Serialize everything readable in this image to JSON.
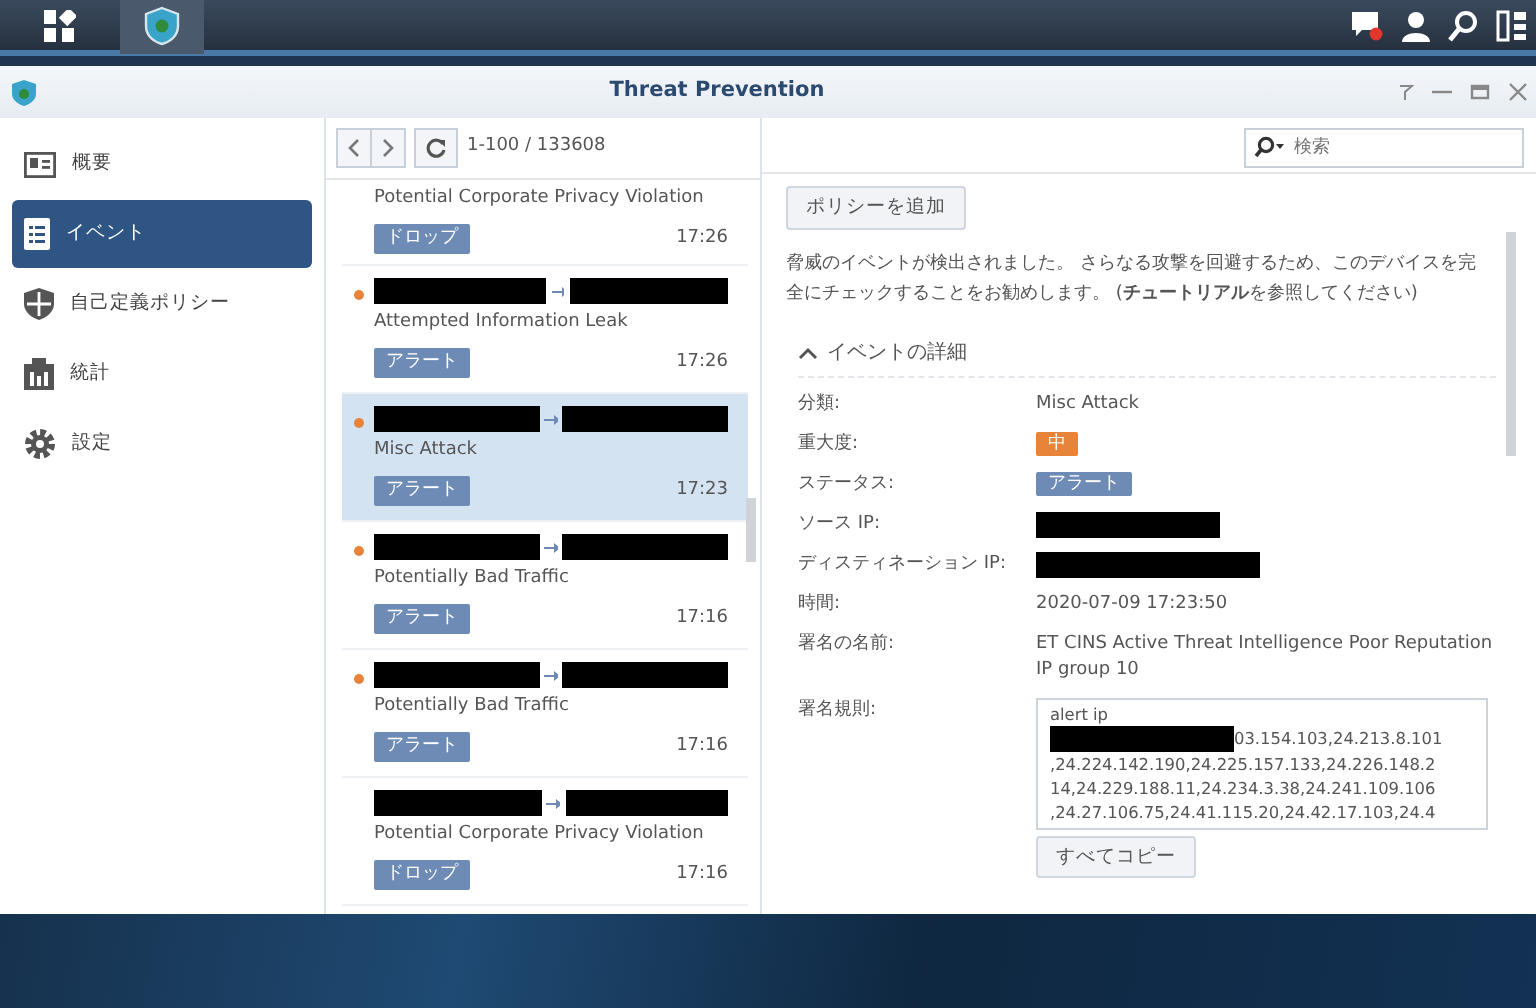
{
  "window": {
    "title": "Threat Prevention"
  },
  "sidebar": {
    "items": [
      {
        "label": "概要",
        "selected": false
      },
      {
        "label": "イベント",
        "selected": true
      },
      {
        "label": "自己定義ポリシー",
        "selected": false
      },
      {
        "label": "統計",
        "selected": false
      },
      {
        "label": "設定",
        "selected": false
      }
    ]
  },
  "toolbar": {
    "pager": "1-100 / 133608",
    "search": {
      "placeholder": "検索"
    }
  },
  "events": [
    {
      "category": "Potential Corporate Privacy Violation",
      "action": "ドロップ",
      "time": "17:26",
      "new": false,
      "selected": false
    },
    {
      "category": "Attempted Information Leak",
      "action": "アラート",
      "time": "17:26",
      "new": true,
      "selected": false
    },
    {
      "category": "Misc Attack",
      "action": "アラート",
      "time": "17:23",
      "new": true,
      "selected": true
    },
    {
      "category": "Potentially Bad Traffic",
      "action": "アラート",
      "time": "17:16",
      "new": true,
      "selected": false
    },
    {
      "category": "Potentially Bad Traffic",
      "action": "アラート",
      "time": "17:16",
      "new": true,
      "selected": false
    },
    {
      "category": "Potential Corporate Privacy Violation",
      "action": "ドロップ",
      "time": "17:16",
      "new": false,
      "selected": false
    }
  ],
  "detail": {
    "add_policy_button": "ポリシーを追加",
    "message": "脅威のイベントが検出されました。 さらなる攻撃を回避するため、このデバイスを完全にチェックすることをお勧めします。 (**チュートリアル**を参照してください)",
    "section": {
      "title": "イベントの詳細",
      "expanded": true
    },
    "fields": [
      {
        "label": "分類:",
        "kind": "text",
        "value": "Misc Attack"
      },
      {
        "label": "重大度:",
        "kind": "badge",
        "value": "中",
        "color": "#e8833a"
      },
      {
        "label": "ステータス:",
        "kind": "badge",
        "value": "アラート",
        "color": "#6d8bb5"
      },
      {
        "label": "ソース IP:",
        "kind": "redacted"
      },
      {
        "label": "ディスティネーション IP:",
        "kind": "redacted"
      },
      {
        "label": "時間:",
        "kind": "text",
        "value": "2020-07-09 17:23:50"
      },
      {
        "label": "署名の名前:",
        "kind": "text",
        "value": "ET CINS Active Threat Intelligence Poor Reputation IP group 10"
      },
      {
        "label": "署名規則:",
        "kind": "rule",
        "lines": [
          "alert ip",
          "03.154.103,24.213.8.101",
          ",24.224.142.190,24.225.157.133,24.226.148.2",
          "14,24.229.188.11,24.234.3.38,24.241.109.106",
          ",24.27.106.75,24.41.115.20,24.42.17.103,24.4"
        ]
      }
    ],
    "copy_button": "すべてコピー"
  }
}
